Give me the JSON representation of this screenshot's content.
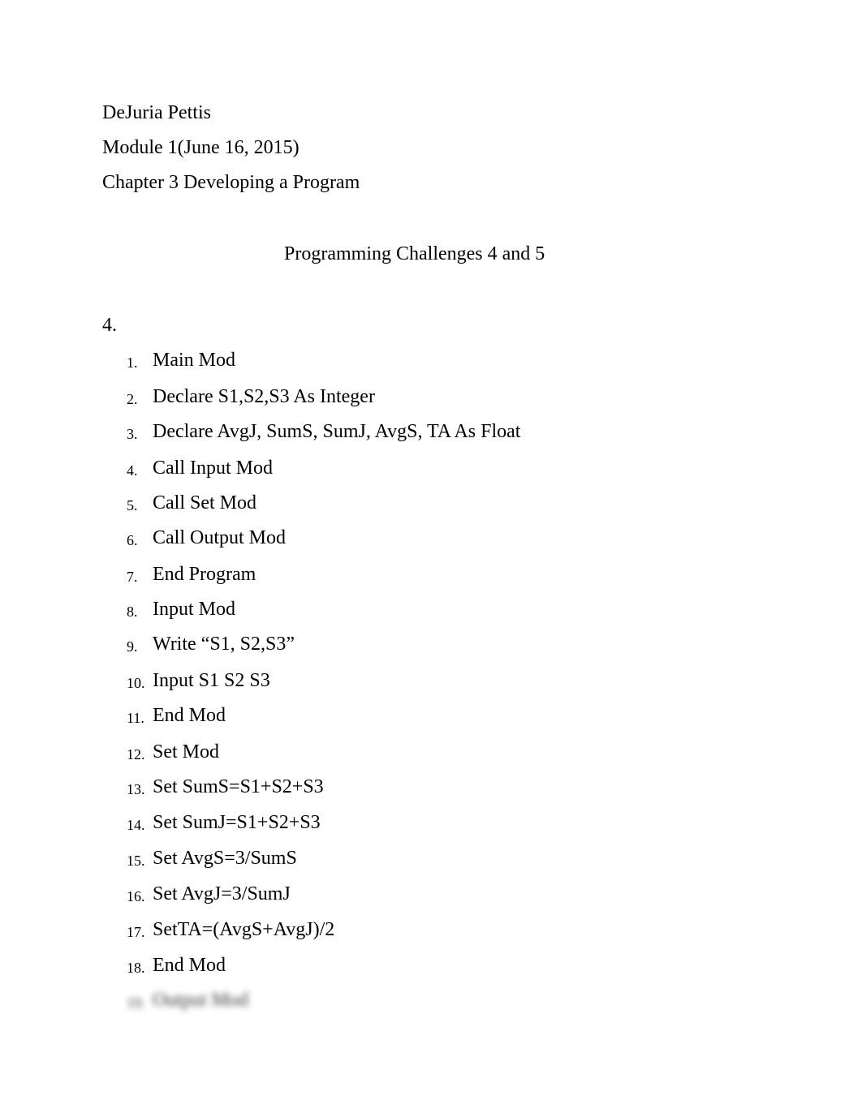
{
  "header": {
    "author": "DeJuria Pettis",
    "module": "Module 1(June 16, 2015)",
    "chapter": "Chapter 3 Developing a Program"
  },
  "title": "Programming Challenges 4 and 5",
  "section_label": "4.",
  "steps": [
    {
      "num": "1.",
      "text": "Main Mod"
    },
    {
      "num": "2.",
      "text": "Declare S1,S2,S3 As Integer"
    },
    {
      "num": "3.",
      "text": "Declare AvgJ, SumS, SumJ, AvgS, TA As Float"
    },
    {
      "num": "4.",
      "text": "Call Input Mod"
    },
    {
      "num": "5.",
      "text": "Call Set Mod"
    },
    {
      "num": "6.",
      "text": "Call Output Mod"
    },
    {
      "num": "7.",
      "text": "End Program"
    },
    {
      "num": "8.",
      "text": "Input Mod"
    },
    {
      "num": "9.",
      "text": "Write “S1, S2,S3”"
    },
    {
      "num": "10.",
      "text": "Input S1 S2 S3"
    },
    {
      "num": "11.",
      "text": "End Mod"
    },
    {
      "num": "12.",
      "text": "Set Mod"
    },
    {
      "num": "13.",
      "text": "Set SumS=S1+S2+S3"
    },
    {
      "num": "14.",
      "text": "Set SumJ=S1+S2+S3"
    },
    {
      "num": "15.",
      "text": "Set AvgS=3/SumS"
    },
    {
      "num": "16.",
      "text": "Set AvgJ=3/SumJ"
    },
    {
      "num": "17.",
      "text": "SetTA=(AvgS+AvgJ)/2"
    },
    {
      "num": "18.",
      "text": "End Mod"
    },
    {
      "num": "19.",
      "text": "Output Mod",
      "blurred": true
    }
  ]
}
